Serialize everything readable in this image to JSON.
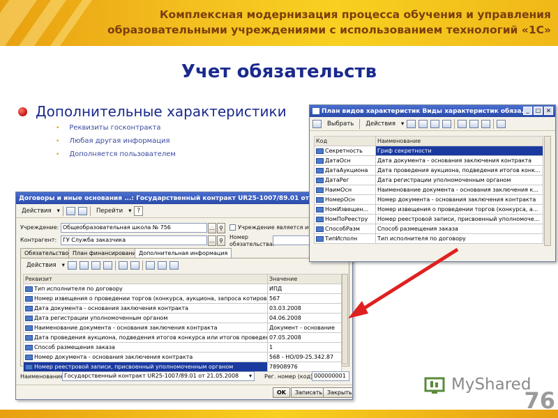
{
  "banner": {
    "line1": "Комплексная модернизация процесса обучения и управления",
    "line2": "образовательными учреждениями с использованием технологий «1С»"
  },
  "slide": {
    "title": "Учет обязательств",
    "bullet": "Дополнительные характеристики",
    "sub_bullets": [
      "Реквизиты госконтракта",
      "Любая другая информация",
      "Дополняется пользователем"
    ]
  },
  "win_plan": {
    "title": "План видов характеристик Виды характеристик обяза...",
    "toolbar": {
      "select": "Выбрать",
      "actions": "Действия"
    },
    "columns": [
      "Код",
      "Наименование"
    ],
    "rows": [
      {
        "code": "Секретность",
        "name": "Гриф секретности"
      },
      {
        "code": "ДатаОсн",
        "name": "Дата документа - основания заключения контракта"
      },
      {
        "code": "ДатаАукциона",
        "name": "Дата проведения аукциона, подведения итогов конк..."
      },
      {
        "code": "ДатаРег",
        "name": "Дата регистрации уполномоченным органом"
      },
      {
        "code": "НаимОсн",
        "name": "Наименование документа - основания заключения к..."
      },
      {
        "code": "НомерОсн",
        "name": "Номер документа - основания заключения контракта"
      },
      {
        "code": "НомИзвещен...",
        "name": "Номер извещения о проведении торгов (конкурса, а..."
      },
      {
        "code": "НомПоРеестру",
        "name": "Номер реестровой записи, присвоенный уполномоче..."
      },
      {
        "code": "СпособРазм",
        "name": "Способ размещения заказа"
      },
      {
        "code": "ТипИсполн",
        "name": "Тип исполнителя по договору"
      }
    ]
  },
  "win_contract": {
    "title": "Договоры и иные основания ...: Государственный контракт UR25-1007/89.01 от 21.05.200",
    "toolbar": {
      "actions": "Действия",
      "goto": "Перейти",
      "help": "?"
    },
    "institution_label": "Учреждение:",
    "institution_value": "Общеобразовательная школа № 756",
    "institution_checkbox": "Учреждение является исп",
    "counterparty_label": "Контрагент:",
    "counterparty_value": "ГУ Служба заказчика",
    "obligation_label": "Номер обязательства:",
    "tabs": [
      "Обязательство",
      "План финансирования",
      "Дополнительная информация"
    ],
    "inner_actions": "Действия",
    "columns": [
      "Реквизит",
      "Значение"
    ],
    "rows": [
      {
        "attr": "Тип исполнителя по договору",
        "value": "ИПД"
      },
      {
        "attr": "Номер извещения о проведении торгов (конкурса, аукциона, запроса котировок)",
        "value": "567"
      },
      {
        "attr": "Дата документа - основания заключения контракта",
        "value": "03.03.2008"
      },
      {
        "attr": "Дата регистрации уполномоченным органом",
        "value": "04.06.2008"
      },
      {
        "attr": "Наименование документа - основания заключения контракта",
        "value": "Документ - основание"
      },
      {
        "attr": "Дата проведения аукциона, подведения итогов конкурса или итогов проведения за...",
        "value": "07.05.2008"
      },
      {
        "attr": "Способ размещения заказа",
        "value": "1"
      },
      {
        "attr": "Номер документа - основания заключения контракта",
        "value": "568 - НО/09-25.342.87"
      },
      {
        "attr": "Номер реестровой записи, присвоенный уполномоченным органом",
        "value": "78908976"
      }
    ],
    "name_label": "Наименование:",
    "name_value": "Государственный контракт UR25-1007/89.01 от 21.05.2008",
    "reg_label": "Рег. номер (код):",
    "reg_value": "000000001",
    "buttons": {
      "ok": "OK",
      "save": "Записать",
      "close": "Закрыть"
    }
  },
  "footer": {
    "logo": "MyShared",
    "page": "76"
  },
  "colors": {
    "banner": "#f4c020",
    "title": "#1a2a8c",
    "selection": "#1a3aa0",
    "arrow": "#e02020"
  }
}
